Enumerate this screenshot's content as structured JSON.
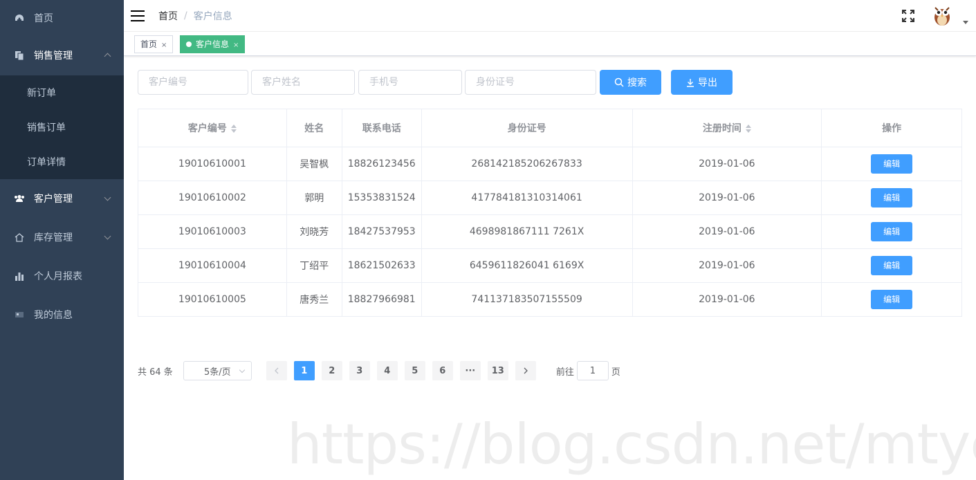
{
  "sidebar": {
    "items": [
      {
        "label": "首页",
        "icon": "dashboard-icon"
      },
      {
        "label": "销售管理",
        "icon": "copy-icon",
        "expanded": true,
        "children": [
          {
            "label": "新订单"
          },
          {
            "label": "销售订单"
          },
          {
            "label": "订单详情"
          }
        ]
      },
      {
        "label": "客户管理",
        "icon": "people-icon",
        "active": true
      },
      {
        "label": "库存管理",
        "icon": "home-icon"
      },
      {
        "label": "个人月报表",
        "icon": "bar-chart-icon"
      },
      {
        "label": "我的信息",
        "icon": "id-card-icon"
      }
    ]
  },
  "navbar": {
    "breadcrumb_home": "首页",
    "breadcrumb_sep": "/",
    "breadcrumb_current": "客户信息"
  },
  "tags": [
    {
      "label": "首页",
      "close": "×"
    },
    {
      "label": "客户信息",
      "close": "×",
      "active": true
    }
  ],
  "filters": {
    "customer_no": "客户编号",
    "customer_name": "客户姓名",
    "phone": "手机号",
    "id_no": "身份证号",
    "search_label": "搜索",
    "export_label": "导出"
  },
  "table": {
    "headers": [
      "客户编号",
      "姓名",
      "联系电话",
      "身份证号",
      "注册时间",
      "操作"
    ],
    "action_label": "编辑",
    "rows": [
      [
        "19010610001",
        "吴智枫",
        "18826123456",
        "268142185206267833",
        "2019-01-06"
      ],
      [
        "19010610002",
        "郭明",
        "15353831524",
        "417784181310314061",
        "2019-01-06"
      ],
      [
        "19010610003",
        "刘晓芳",
        "18427537953",
        "4698981867111 7261X",
        "2019-01-06"
      ],
      [
        "19010610004",
        "丁绍平",
        "18621502633",
        "6459611826041 6169X",
        "2019-01-06"
      ],
      [
        "19010610005",
        "唐秀兰",
        "18827966981",
        "741137183507155509",
        "2019-01-06"
      ]
    ]
  },
  "pagination": {
    "total_text": "共 64 条",
    "page_size": "5条/页",
    "pages": [
      "1",
      "2",
      "3",
      "4",
      "5",
      "6",
      "···",
      "13"
    ],
    "current": "1",
    "goto_label": "前往",
    "goto_value": "1",
    "page_suffix": "页"
  },
  "watermark": "https://blog.csdn.net/mtyedu",
  "colors": {
    "sidebar_bg": "#304156",
    "submenu_bg": "#1f2d3d",
    "primary": "#409eff",
    "tag_active": "#42b983"
  }
}
